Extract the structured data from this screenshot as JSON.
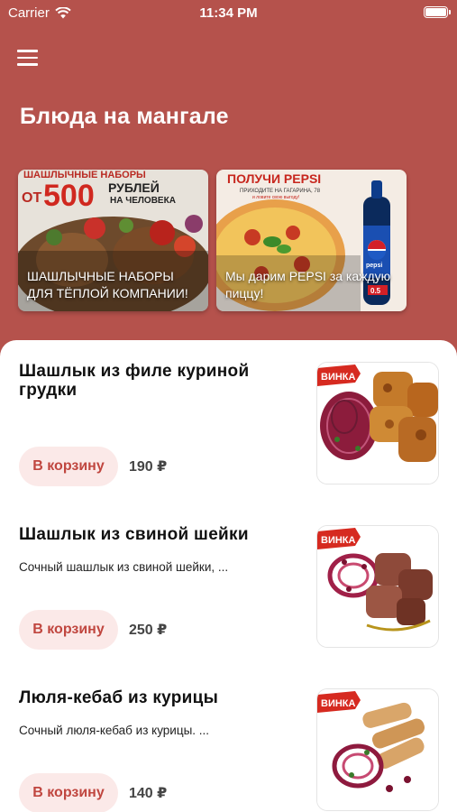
{
  "status_bar": {
    "carrier": "Carrier",
    "time": "11:34 PM"
  },
  "header": {
    "title": "Блюда на мангале",
    "menu_icon": "hamburger-menu-icon"
  },
  "banners": [
    {
      "caption": "ШАШЛЫЧНЫЕ НАБОРЫ ДЛЯ ТЁПЛОЙ КОМПАНИИ!",
      "image_text_top": "ШАШЛЫЧНЫЕ НАБОРЫ",
      "image_text_from": "ОТ",
      "image_text_amount": "500",
      "image_text_rub": "РУБЛЕЙ",
      "image_text_per": "НА ЧЕЛОВЕКА"
    },
    {
      "caption": "Мы дарим PEPSI за каждую пиццу!",
      "image_text_top": "ПОЛУЧИ PEPSI",
      "image_text_sub": "ПРИХОДИТЕ НА ГАГАРИНА, 78",
      "image_text_sub2": "и ловите свою выгоду!",
      "bottle_label": "pepsi",
      "bottle_volume": "0.5"
    }
  ],
  "products": [
    {
      "name": "Шашлык из филе куриной грудки",
      "description": "",
      "button_label": "В корзину",
      "price": "190 ₽",
      "badge": "ВИНКА"
    },
    {
      "name": "Шашлык из свиной шейки",
      "description": "Сочный шашлык из свиной шейки, ...",
      "button_label": "В корзину",
      "price": "250 ₽",
      "badge": "ВИНКА"
    },
    {
      "name": "Люля-кебаб из курицы",
      "description": "Сочный люля-кебаб из курицы. ...",
      "button_label": "В корзину",
      "price": "140 ₽",
      "badge": "ВИНКА"
    }
  ],
  "colors": {
    "brand": "#b5524c",
    "button_bg": "#fbe9e8",
    "button_text": "#c0463f"
  }
}
